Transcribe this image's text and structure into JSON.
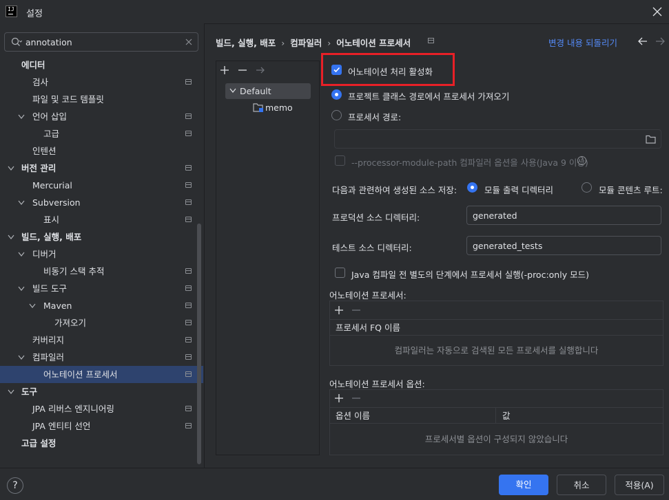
{
  "window": {
    "title": "설정"
  },
  "search": {
    "value": "annotation"
  },
  "sidebar": {
    "items": [
      {
        "label": "에디터",
        "level": 0,
        "bold": true,
        "expand": "none",
        "badge": false
      },
      {
        "label": "검사",
        "level": 1,
        "bold": false,
        "expand": "none",
        "badge": true
      },
      {
        "label": "파일 및 코드 템플릿",
        "level": 1,
        "bold": false,
        "expand": "none",
        "badge": false
      },
      {
        "label": "언어 삽입",
        "level": 1,
        "bold": false,
        "expand": "open",
        "badge": true
      },
      {
        "label": "고급",
        "level": 2,
        "bold": false,
        "expand": "none",
        "badge": true
      },
      {
        "label": "인텐션",
        "level": 1,
        "bold": false,
        "expand": "none",
        "badge": false
      },
      {
        "label": "버전 관리",
        "level": 0,
        "bold": true,
        "expand": "open",
        "badge": true
      },
      {
        "label": "Mercurial",
        "level": 1,
        "bold": false,
        "expand": "none",
        "badge": true
      },
      {
        "label": "Subversion",
        "level": 1,
        "bold": false,
        "expand": "open",
        "badge": true
      },
      {
        "label": "표시",
        "level": 2,
        "bold": false,
        "expand": "none",
        "badge": true
      },
      {
        "label": "빌드, 실행, 배포",
        "level": 0,
        "bold": true,
        "expand": "open",
        "badge": false
      },
      {
        "label": "디버거",
        "level": 1,
        "bold": false,
        "expand": "open",
        "badge": false
      },
      {
        "label": "비동기 스택 추적",
        "level": 2,
        "bold": false,
        "expand": "none",
        "badge": true
      },
      {
        "label": "빌드 도구",
        "level": 1,
        "bold": false,
        "expand": "open",
        "badge": true
      },
      {
        "label": "Maven",
        "level": 2,
        "bold": false,
        "expand": "open",
        "badge": true
      },
      {
        "label": "가져오기",
        "level": 3,
        "bold": false,
        "expand": "none",
        "badge": true
      },
      {
        "label": "커버리지",
        "level": 1,
        "bold": false,
        "expand": "none",
        "badge": true
      },
      {
        "label": "컴파일러",
        "level": 1,
        "bold": false,
        "expand": "open",
        "badge": true
      },
      {
        "label": "어노테이션 프로세서",
        "level": 2,
        "bold": false,
        "expand": "none",
        "badge": true,
        "selected": true
      },
      {
        "label": "도구",
        "level": 0,
        "bold": true,
        "expand": "open",
        "badge": false
      },
      {
        "label": "JPA 리버스 엔지니어링",
        "level": 1,
        "bold": false,
        "expand": "none",
        "badge": true
      },
      {
        "label": "JPA 엔티티 선언",
        "level": 1,
        "bold": false,
        "expand": "none",
        "badge": true
      },
      {
        "label": "고급 설정",
        "level": 0,
        "bold": true,
        "expand": "none",
        "badge": false
      }
    ]
  },
  "breadcrumb": [
    "빌드, 실행, 배포",
    "컴파일러",
    "어노테이션 프로세서"
  ],
  "header": {
    "reset_label": "변경 내용 되돌리기"
  },
  "profiles": {
    "default_label": "Default",
    "module_label": "memo"
  },
  "options": {
    "enable_label": "어노테이션 처리 활성화",
    "enable_checked": true,
    "classpath_label": "프로젝트 클래스 경로에서 프로세서 가져오기",
    "processor_path_label": "프로세서 경로:",
    "processor_path_value": "",
    "module_path_label": "--processor-module-path 컴파일러 옵션을 사용(Java 9 이상)",
    "store_label": "다음과 관련하여 생성된 소스 저장:",
    "store_opt1": "모듈 출력 디렉터리",
    "store_opt2": "모듈 콘텐츠 루트:",
    "prod_dir_label": "프로덕션 소스 디렉터리:",
    "prod_dir_value": "generated",
    "test_dir_label": "테스트 소스 디렉터리:",
    "test_dir_value": "generated_tests",
    "proc_only_label": "Java 컴파일 전 별도의 단계에서 프로세서 실행(-proc:only 모드)"
  },
  "processors": {
    "section_label": "어노테이션 프로세서:",
    "column": "프로세서 FQ 이름",
    "empty": "컴파일러는 자동으로 검색된 모든 프로세서를 실행합니다"
  },
  "processor_options": {
    "section_label": "어노테이션 프로세서 옵션:",
    "col_name": "옵션 이름",
    "col_value": "값",
    "empty": "프로세서별 옵션이 구성되지 않았습니다"
  },
  "footer": {
    "help": "?",
    "ok": "확인",
    "cancel": "취소",
    "apply": "적용(A)"
  },
  "colors": {
    "accent": "#3574f0",
    "highlight": "#e82027",
    "link": "#548af7",
    "selection": "#2e436e"
  }
}
